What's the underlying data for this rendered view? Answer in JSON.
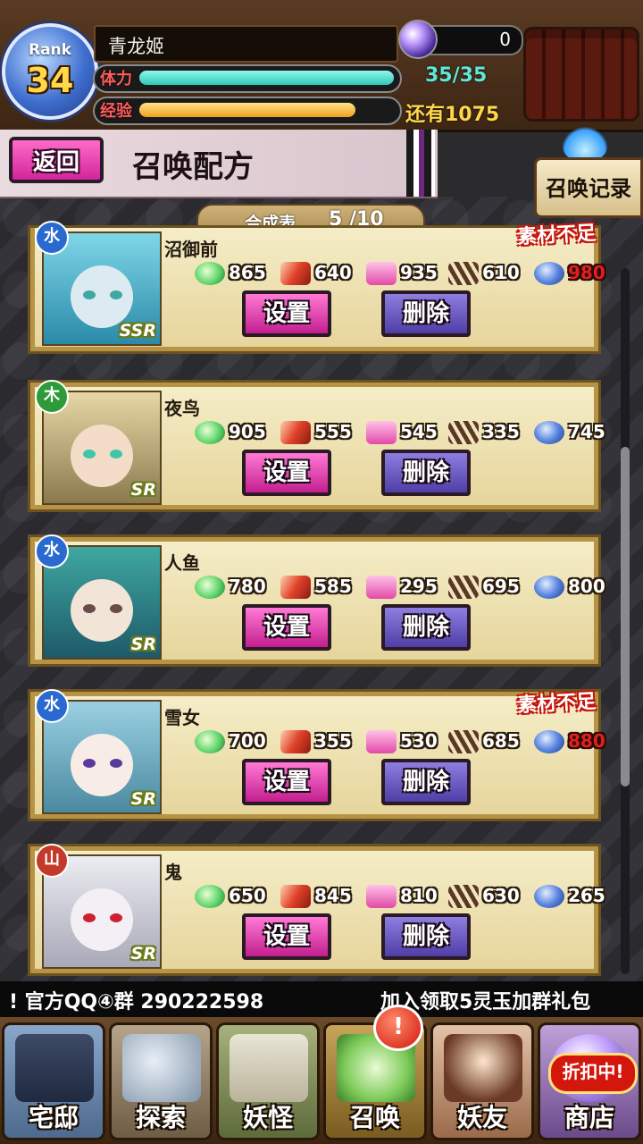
{
  "player": {
    "rank_label": "Rank",
    "rank": "34",
    "name": "青龙姬",
    "gems": "0",
    "stamina_label": "体力",
    "stamina": "35/35",
    "stamina_fraction": 1.0,
    "exp_label": "经验",
    "exp_remaining": "还有1075",
    "exp_fraction": 0.85
  },
  "header": {
    "back_label": "返回",
    "title": "召唤配方",
    "history_label": "召唤记录",
    "count_label": "合成表",
    "count_value": "5 /10"
  },
  "recipes": [
    {
      "name": "沼御前",
      "rarity": "SSR",
      "attribute": "水",
      "shortage": "素材不足",
      "materials": [
        {
          "icon": "green-orb-icon",
          "value": "865",
          "short": false
        },
        {
          "icon": "red-fish-icon",
          "value": "640",
          "short": false
        },
        {
          "icon": "pink-cloth-icon",
          "value": "935",
          "short": false
        },
        {
          "icon": "feather-icon",
          "value": "610",
          "short": false
        },
        {
          "icon": "blue-egg-icon",
          "value": "980",
          "short": true
        }
      ],
      "set_label": "设置",
      "delete_label": "删除"
    },
    {
      "name": "夜鸟",
      "rarity": "SR",
      "attribute": "木",
      "shortage": "",
      "materials": [
        {
          "icon": "green-orb-icon",
          "value": "905",
          "short": false
        },
        {
          "icon": "red-fish-icon",
          "value": "555",
          "short": false
        },
        {
          "icon": "pink-cloth-icon",
          "value": "545",
          "short": false
        },
        {
          "icon": "feather-icon",
          "value": "335",
          "short": false
        },
        {
          "icon": "blue-egg-icon",
          "value": "745",
          "short": false
        }
      ],
      "set_label": "设置",
      "delete_label": "删除"
    },
    {
      "name": "人鱼",
      "rarity": "SR",
      "attribute": "水",
      "shortage": "",
      "materials": [
        {
          "icon": "green-orb-icon",
          "value": "780",
          "short": false
        },
        {
          "icon": "red-fish-icon",
          "value": "585",
          "short": false
        },
        {
          "icon": "pink-cloth-icon",
          "value": "295",
          "short": false
        },
        {
          "icon": "feather-icon",
          "value": "695",
          "short": false
        },
        {
          "icon": "blue-egg-icon",
          "value": "800",
          "short": false
        }
      ],
      "set_label": "设置",
      "delete_label": "删除"
    },
    {
      "name": "雪女",
      "rarity": "SR",
      "attribute": "水",
      "shortage": "素材不足",
      "materials": [
        {
          "icon": "green-orb-icon",
          "value": "700",
          "short": false
        },
        {
          "icon": "red-fish-icon",
          "value": "355",
          "short": false
        },
        {
          "icon": "pink-cloth-icon",
          "value": "530",
          "short": false
        },
        {
          "icon": "feather-icon",
          "value": "685",
          "short": false
        },
        {
          "icon": "blue-egg-icon",
          "value": "880",
          "short": true
        }
      ],
      "set_label": "设置",
      "delete_label": "删除"
    },
    {
      "name": "鬼",
      "rarity": "SR",
      "attribute": "山",
      "shortage": "",
      "materials": [
        {
          "icon": "green-orb-icon",
          "value": "650",
          "short": false
        },
        {
          "icon": "red-fish-icon",
          "value": "845",
          "short": false
        },
        {
          "icon": "pink-cloth-icon",
          "value": "810",
          "short": false
        },
        {
          "icon": "feather-icon",
          "value": "630",
          "short": false
        },
        {
          "icon": "blue-egg-icon",
          "value": "265",
          "short": false
        }
      ],
      "set_label": "设置",
      "delete_label": "删除"
    }
  ],
  "marquee": {
    "left": "! 官方QQ④群 290222598",
    "right": "加入领取5灵玉加群礼包"
  },
  "nav": {
    "items": [
      {
        "label": "宅邸"
      },
      {
        "label": "探索"
      },
      {
        "label": "妖怪"
      },
      {
        "label": "召唤"
      },
      {
        "label": "妖友"
      },
      {
        "label": "商店"
      }
    ],
    "alert": "!",
    "sale": "折扣中!"
  },
  "colors": {
    "set_button": "#d52fa3",
    "delete_button": "#5f4db8",
    "shortage": "#c4140c",
    "stamina": "#5fe7d7",
    "exp": "#ffd84a"
  }
}
